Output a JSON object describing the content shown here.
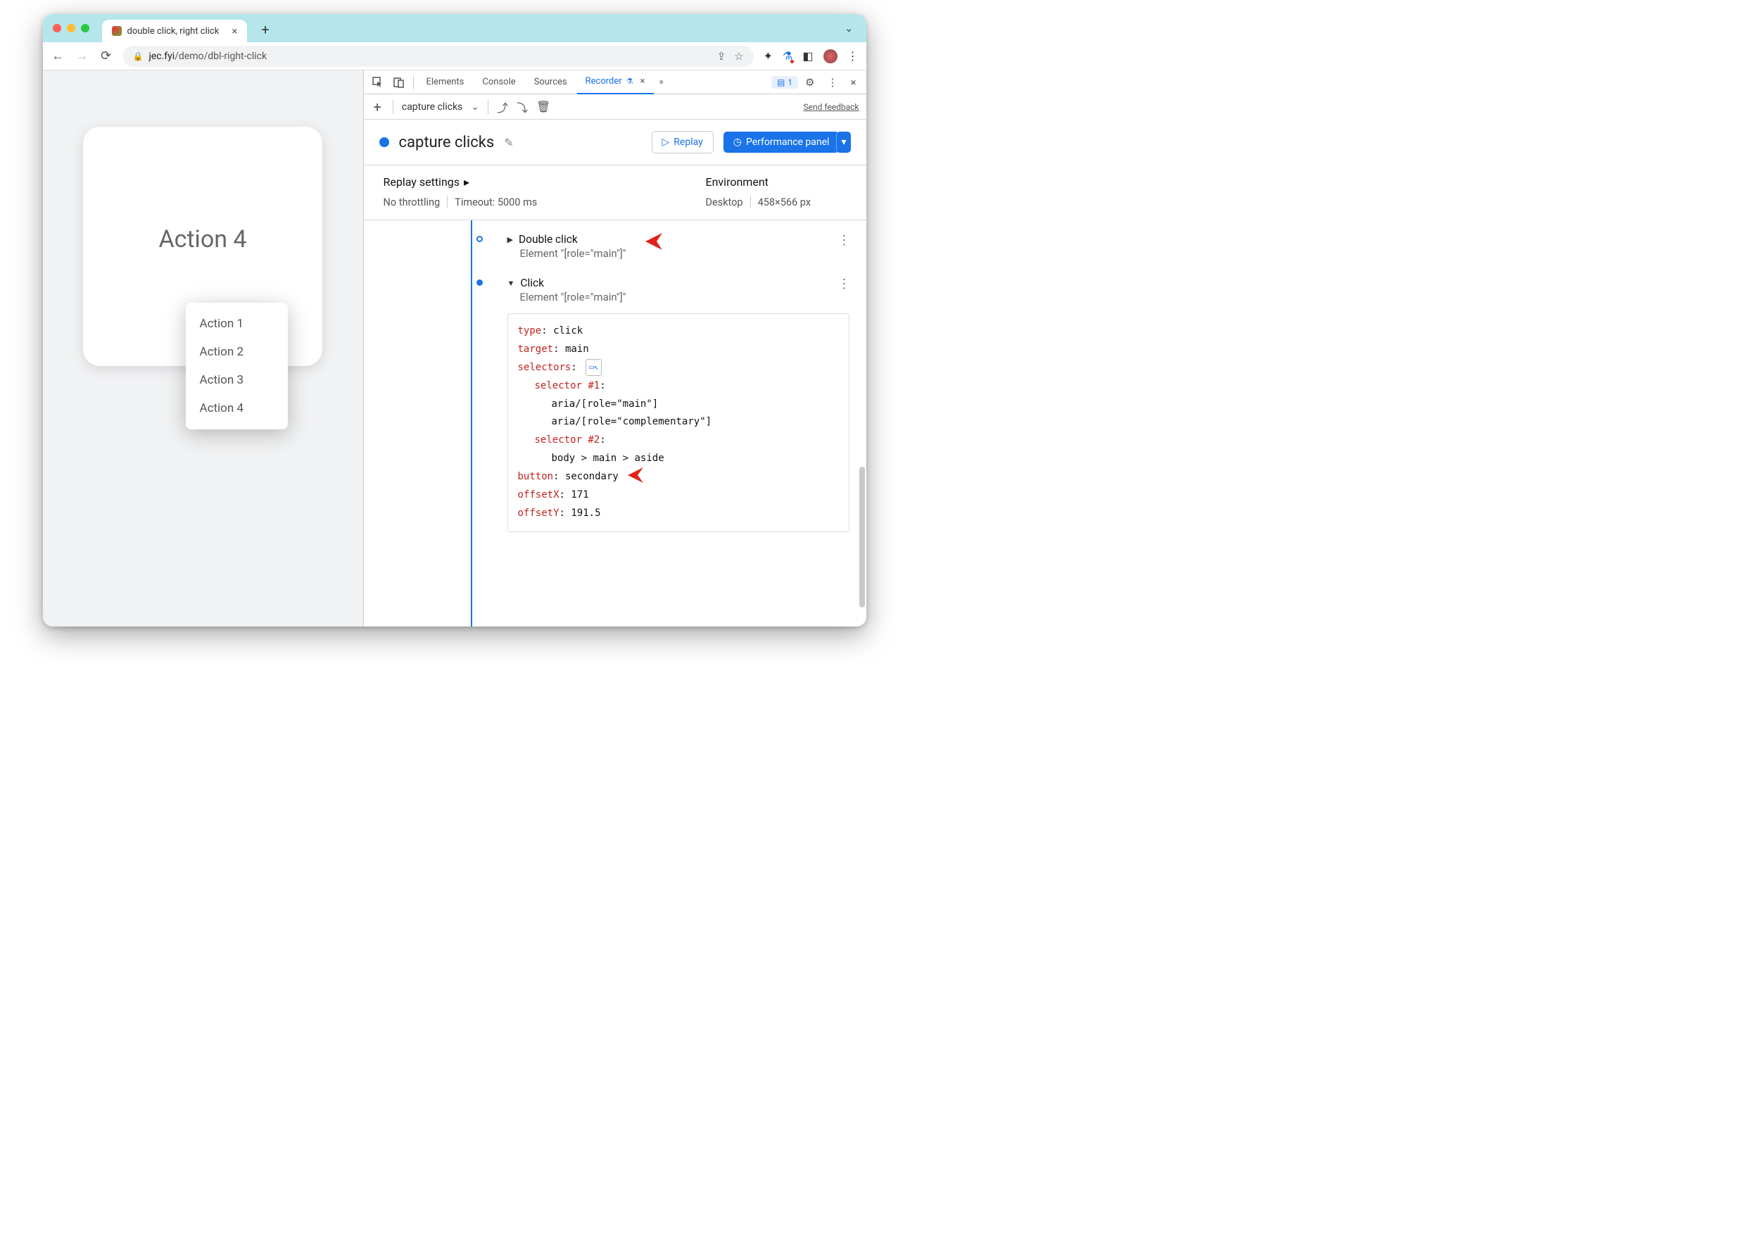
{
  "browser": {
    "tab_title": "double click, right click",
    "url_host": "jec.fyi",
    "url_path": "/demo/dbl-right-click"
  },
  "page": {
    "card_title": "Action 4",
    "menu_items": [
      "Action 1",
      "Action 2",
      "Action 3",
      "Action 4"
    ]
  },
  "devtools": {
    "tabs": [
      "Elements",
      "Console",
      "Sources"
    ],
    "active_tab": "Recorder",
    "issues_count": "1",
    "toolbar": {
      "recording_name": "capture clicks",
      "feedback_link": "Send feedback"
    },
    "header": {
      "title": "capture clicks",
      "replay_btn": "Replay",
      "perf_btn": "Performance panel"
    },
    "settings": {
      "replay_label": "Replay settings",
      "throttling": "No throttling",
      "timeout": "Timeout: 5000 ms",
      "env_label": "Environment",
      "device": "Desktop",
      "dimensions": "458×566 px"
    },
    "steps": [
      {
        "title": "Double click",
        "subtitle": "Element \"[role=\"main\"]\"",
        "expanded": false
      },
      {
        "title": "Click",
        "subtitle": "Element \"[role=\"main\"]\"",
        "expanded": true,
        "detail": {
          "type_k": "type",
          "type_v": "click",
          "target_k": "target",
          "target_v": "main",
          "selectors_k": "selectors",
          "sel1_k": "selector #1",
          "sel1_a": "aria/[role=\"main\"]",
          "sel1_b": "aria/[role=\"complementary\"]",
          "sel2_k": "selector #2",
          "sel2_a": "body > main > aside",
          "button_k": "button",
          "button_v": "secondary",
          "offx_k": "offsetX",
          "offx_v": "171",
          "offy_k": "offsetY",
          "offy_v": "191.5"
        }
      }
    ]
  }
}
